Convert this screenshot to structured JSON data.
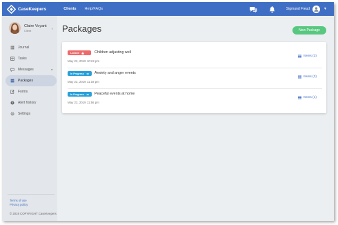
{
  "topbar": {
    "brand": "CaseKeepers",
    "nav": [
      {
        "label": "Clients",
        "active": true
      },
      {
        "label": "Help/FAQs",
        "active": false
      }
    ],
    "user_name": "Sigmund Freud",
    "icons": [
      "chat-icon",
      "bell-icon",
      "user-avatar-icon",
      "chevron-down-icon"
    ]
  },
  "sidebar": {
    "profile": {
      "name": "Claire Voyant",
      "role": "Client"
    },
    "items": [
      {
        "label": "Journal",
        "icon": "journal-icon",
        "active": false
      },
      {
        "label": "Tasks",
        "icon": "tasks-icon",
        "active": false
      },
      {
        "label": "Messages",
        "icon": "messages-icon",
        "active": false,
        "has_caret": true
      },
      {
        "label": "Packages",
        "icon": "packages-icon",
        "active": true
      },
      {
        "label": "Forms",
        "icon": "forms-icon",
        "active": false
      },
      {
        "label": "Alert history",
        "icon": "alert-icon",
        "active": false
      },
      {
        "label": "Settings",
        "icon": "gear-icon",
        "active": false
      }
    ],
    "terms": "Terms of use",
    "privacy": "Privacy policy",
    "copyright": "© 2019 COPYRIGHT CaseKeepers"
  },
  "main": {
    "title": "Packages",
    "new_button": "New Package",
    "packages": [
      {
        "status": "Locked",
        "status_type": "locked",
        "name": "Children adjusting well",
        "date": "May 22, 2019 10:22 pm",
        "items": "Items (3)"
      },
      {
        "status": "In Progress",
        "status_type": "progress",
        "name": "Anxiety and anger events",
        "date": "May 22, 2019 11:19 pm",
        "items": "Items (3)"
      },
      {
        "status": "In Progress",
        "status_type": "progress",
        "name": "Peaceful events at home",
        "date": "May 22, 2019 11:56 pm",
        "items": "Items (1)"
      }
    ]
  },
  "colors": {
    "topbar": "#3f6fc4",
    "accent_green": "#58c77f",
    "locked": "#ee6a6a",
    "in_progress": "#2a9fd8",
    "link": "#3f6fc4"
  }
}
